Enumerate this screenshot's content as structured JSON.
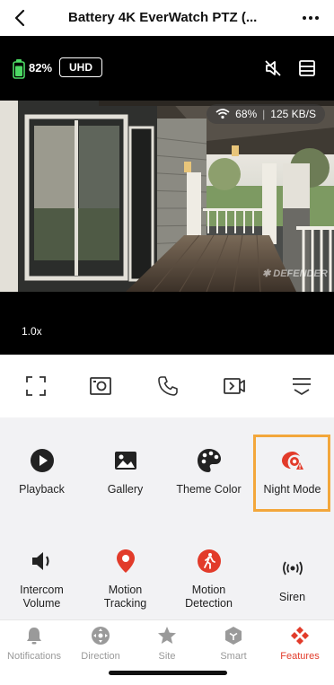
{
  "header": {
    "title": "Battery 4K EverWatch PTZ (...",
    "back_icon": "chevron-left-icon",
    "more_icon": "more-horizontal-icon"
  },
  "video": {
    "battery_percent": "82%",
    "battery_level": 0.82,
    "quality_badge": "UHD",
    "wifi_signal": "68%",
    "bitrate": "125 KB/S",
    "watermark": "DEFENDER",
    "zoom_level": "1.0x"
  },
  "controls": [
    {
      "name": "fullscreen",
      "icon": "fullscreen-icon"
    },
    {
      "name": "snapshot",
      "icon": "camera-snapshot-icon"
    },
    {
      "name": "call",
      "icon": "phone-icon"
    },
    {
      "name": "record",
      "icon": "video-record-icon"
    },
    {
      "name": "collapse",
      "icon": "collapse-panel-icon"
    }
  ],
  "features": [
    {
      "label": "Playback",
      "icon": "play-circle-icon"
    },
    {
      "label": "Gallery",
      "icon": "image-icon"
    },
    {
      "label": "Theme Color",
      "icon": "palette-icon"
    },
    {
      "label": "Night Mode",
      "icon": "night-mode-icon"
    },
    {
      "label": "Intercom Volume",
      "label_line1": "Intercom",
      "label_line2": "Volume",
      "icon": "speaker-icon"
    },
    {
      "label": "Motion Tracking",
      "label_line1": "Motion",
      "label_line2": "Tracking",
      "icon": "location-pin-icon"
    },
    {
      "label": "Motion Detection",
      "label_line1": "Motion",
      "label_line2": "Detection",
      "icon": "walking-person-icon"
    },
    {
      "label": "Siren",
      "icon": "siren-icon"
    }
  ],
  "nav": [
    {
      "label": "Notifications",
      "icon": "bell-icon",
      "active": false
    },
    {
      "label": "Direction",
      "icon": "direction-pad-icon",
      "active": false
    },
    {
      "label": "Site",
      "icon": "star-icon",
      "active": false
    },
    {
      "label": "Smart",
      "icon": "hexagon-icon",
      "active": false
    },
    {
      "label": "Features",
      "icon": "features-icon",
      "active": true
    }
  ],
  "colors": {
    "accent": "#e23b2a",
    "highlight": "#f3a73b",
    "battery": "#4cd964",
    "panel_bg": "#f2f2f4"
  }
}
